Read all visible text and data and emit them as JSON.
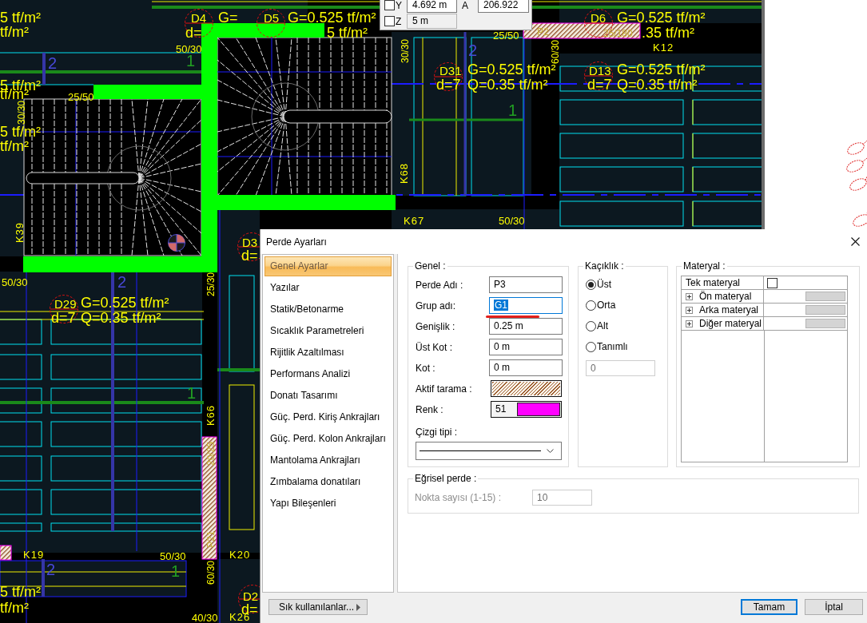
{
  "drawing": {
    "labels": [
      {
        "text": "5 tf/m²",
        "kind": "load"
      },
      {
        "text": "tf/m²",
        "kind": "load"
      },
      {
        "text": "D4",
        "kind": "slab"
      },
      {
        "text": "G=",
        "kind": "load"
      },
      {
        "text": "d=",
        "kind": "load"
      },
      {
        "text": "D5",
        "kind": "slab"
      },
      {
        "text": "G=0.525 tf/m²",
        "kind": "load"
      },
      {
        "text": "5 tf/m²",
        "kind": "load"
      },
      {
        "text": "25/50",
        "kind": "dim"
      },
      {
        "text": "P2",
        "kind": "faint"
      },
      {
        "text": "25/180",
        "kind": "faint"
      },
      {
        "text": "D6",
        "kind": "slab"
      },
      {
        "text": "G=0.525 tf/m²",
        "kind": "load"
      },
      {
        "text": ".35 tf/m²",
        "kind": "load"
      },
      {
        "text": "50/30",
        "kind": "dim"
      },
      {
        "text": "30/30",
        "kind": "dimv"
      },
      {
        "text": "2",
        "kind": "axis2"
      },
      {
        "text": "60/30",
        "kind": "dimv"
      },
      {
        "text": "K12",
        "kind": "beam"
      },
      {
        "text": "2",
        "kind": "axis2"
      },
      {
        "text": "1",
        "kind": "axis1"
      },
      {
        "text": "5 tf/m²",
        "kind": "load"
      },
      {
        "text": "tf/m²",
        "kind": "load"
      },
      {
        "text": "25/50",
        "kind": "dim"
      },
      {
        "text": "D31",
        "kind": "slab"
      },
      {
        "text": "G=0.525 tf/m²",
        "kind": "load"
      },
      {
        "text": "d=7",
        "kind": "load"
      },
      {
        "text": "Q=0.35 tf/m²",
        "kind": "load"
      },
      {
        "text": "D13",
        "kind": "slab"
      },
      {
        "text": "G=0.525 tf/m²",
        "kind": "load"
      },
      {
        "text": "d=7",
        "kind": "load"
      },
      {
        "text": "Q=0.35 tf/m²",
        "kind": "load"
      },
      {
        "text": "30/30",
        "kind": "dimv"
      },
      {
        "text": "1",
        "kind": "axis1"
      },
      {
        "text": "5 tf/m²",
        "kind": "load"
      },
      {
        "text": "tf/m²",
        "kind": "load"
      },
      {
        "text": "K68",
        "kind": "beamv"
      },
      {
        "text": "K67",
        "kind": "beam"
      },
      {
        "text": "50/30",
        "kind": "dim"
      },
      {
        "text": "K39",
        "kind": "beamv"
      },
      {
        "text": "D3",
        "kind": "slab"
      },
      {
        "text": "d=",
        "kind": "load"
      },
      {
        "text": "50/30",
        "kind": "dim"
      },
      {
        "text": "2",
        "kind": "axis2"
      },
      {
        "text": "25/30",
        "kind": "dimv"
      },
      {
        "text": "D29",
        "kind": "slab"
      },
      {
        "text": "G=0.525 tf/m²",
        "kind": "load"
      },
      {
        "text": "d=7",
        "kind": "load"
      },
      {
        "text": "Q=0.35 tf/m²",
        "kind": "load"
      },
      {
        "text": "1",
        "kind": "axis1"
      },
      {
        "text": "K66",
        "kind": "beamv"
      },
      {
        "text": "20/25",
        "kind": "faintv"
      },
      {
        "text": "P21",
        "kind": "faintv"
      },
      {
        "text": "K19",
        "kind": "beam"
      },
      {
        "text": "50/30",
        "kind": "dim"
      },
      {
        "text": "K20",
        "kind": "beam"
      },
      {
        "text": "2",
        "kind": "axis2"
      },
      {
        "text": "1",
        "kind": "axis1"
      },
      {
        "text": "60/30",
        "kind": "dimv"
      },
      {
        "text": "5 tf/m²",
        "kind": "load"
      },
      {
        "text": "tf/m²",
        "kind": "load"
      },
      {
        "text": "D2",
        "kind": "slab"
      },
      {
        "text": "d=",
        "kind": "load"
      },
      {
        "text": "40/30",
        "kind": "dim"
      },
      {
        "text": "K26",
        "kind": "beam"
      }
    ]
  },
  "coordinates": {
    "rows": [
      {
        "label": "Y",
        "checked": false,
        "value": "4.692 m",
        "disabled": false,
        "second_label": "A",
        "second_value": "206.922"
      },
      {
        "label": "Z",
        "checked": false,
        "value": "5 m",
        "disabled": true
      }
    ]
  },
  "dialog": {
    "title": "Perde Ayarları",
    "nav": [
      {
        "label": "Genel Ayarlar",
        "selected": true
      },
      {
        "label": "Yazılar",
        "selected": false
      },
      {
        "label": "Statik/Betonarme",
        "selected": false
      },
      {
        "label": "Sıcaklık Parametreleri",
        "selected": false
      },
      {
        "label": "Rijitlik Azaltılması",
        "selected": false
      },
      {
        "label": "Performans Analizi",
        "selected": false
      },
      {
        "label": "Donatı Tasarımı",
        "selected": false
      },
      {
        "label": "Güç. Perd. Kiriş Ankrajları",
        "selected": false
      },
      {
        "label": "Güç. Perd. Kolon Ankrajları",
        "selected": false
      },
      {
        "label": "Mantolama Ankrajları",
        "selected": false
      },
      {
        "label": "Zımbalama donatıları",
        "selected": false
      },
      {
        "label": "Yapı Bileşenleri",
        "selected": false
      }
    ],
    "favorites_button": "Sık kullanılanlar...",
    "general": {
      "title": "Genel :",
      "fields": [
        {
          "kind": "text",
          "label": "Perde Adı :",
          "value": "P3",
          "focused": false,
          "underlined": false
        },
        {
          "kind": "text",
          "label": "Grup adı:",
          "value": "G1",
          "focused": true,
          "underlined": true
        },
        {
          "kind": "text",
          "label": "Genişlik :",
          "value": "0.25 m",
          "focused": false,
          "underlined": false
        },
        {
          "kind": "text",
          "label": "Üst Kot :",
          "value": "0 m",
          "focused": false,
          "underlined": false
        },
        {
          "kind": "text",
          "label": "Kot :",
          "value": "0 m",
          "focused": false,
          "underlined": false
        },
        {
          "kind": "hatch",
          "label": "Aktif tarama :",
          "focused": false,
          "underlined": false
        },
        {
          "kind": "color",
          "label": "Renk :",
          "value": "51",
          "color": "#ff00ff",
          "focused": false,
          "underlined": false
        }
      ],
      "line_type": {
        "label": "Çizgi tipi :"
      }
    },
    "offset": {
      "title": "Kaçıklık :",
      "options": [
        {
          "label": "Üst",
          "selected": true
        },
        {
          "label": "Orta",
          "selected": false
        },
        {
          "label": "Alt",
          "selected": false
        },
        {
          "label": "Tanımlı",
          "selected": false
        }
      ],
      "custom_value": "0",
      "custom_disabled": true
    },
    "material": {
      "title": "Materyal :",
      "rows": [
        {
          "kind": "checkbox",
          "label": "Tek materyal",
          "checked": false
        },
        {
          "kind": "group",
          "label": "Ön materyal",
          "expanded": false
        },
        {
          "kind": "group",
          "label": "Arka materyal",
          "expanded": false
        },
        {
          "kind": "group",
          "label": "Diğer materyal",
          "expanded": false
        }
      ]
    },
    "curved": {
      "title": "Eğrisel perde :",
      "label": "Nokta sayısı (1-15) :",
      "value": "10",
      "disabled": true
    },
    "buttons": [
      {
        "label": "Tamam",
        "default": true
      },
      {
        "label": "İptal",
        "default": false
      }
    ]
  }
}
